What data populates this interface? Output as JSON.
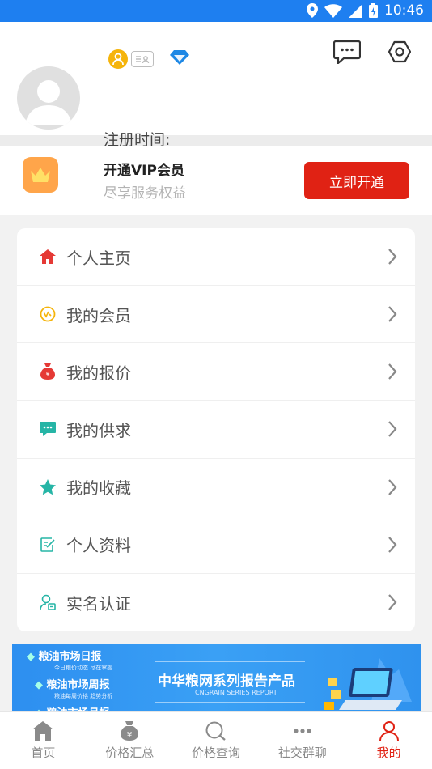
{
  "status": {
    "time": "10:46"
  },
  "header": {
    "register_label": "注册时间:"
  },
  "vip": {
    "title": "开通VIP会员",
    "subtitle": "尽享服务权益",
    "button": "立即开通"
  },
  "menu": [
    {
      "label": "个人主页",
      "icon": "home-icon",
      "color": "#e53935"
    },
    {
      "label": "我的会员",
      "icon": "member-icon",
      "color": "#f5b40b"
    },
    {
      "label": "我的报价",
      "icon": "money-bag-icon",
      "color": "#e53935"
    },
    {
      "label": "我的供求",
      "icon": "chat-icon",
      "color": "#26b5a6"
    },
    {
      "label": "我的收藏",
      "icon": "star-icon",
      "color": "#26b5a6"
    },
    {
      "label": "个人资料",
      "icon": "edit-icon",
      "color": "#26b5a6"
    },
    {
      "label": "实名认证",
      "icon": "verify-icon",
      "color": "#26b5a6"
    }
  ],
  "banner": {
    "lines": [
      "粮油市场日报",
      "粮油市场周报",
      "粮油市场月报"
    ],
    "subs": [
      "今日粮价动态 尽在掌握",
      "粮油每周价格 趋势分析"
    ],
    "title": "中华粮网系列报告产品",
    "subtitle": "CNGRAIN SERIES REPORT"
  },
  "tabs": [
    {
      "label": "首页",
      "icon": "home-icon"
    },
    {
      "label": "价格汇总",
      "icon": "money-bag-icon"
    },
    {
      "label": "价格查询",
      "icon": "search-icon"
    },
    {
      "label": "社交群聊",
      "icon": "more-dots-icon"
    },
    {
      "label": "我的",
      "icon": "user-icon",
      "active": true
    }
  ],
  "colors": {
    "primary_blue": "#1e7ff0",
    "accent_red": "#e02214",
    "vip_orange": "#ffa54a"
  }
}
